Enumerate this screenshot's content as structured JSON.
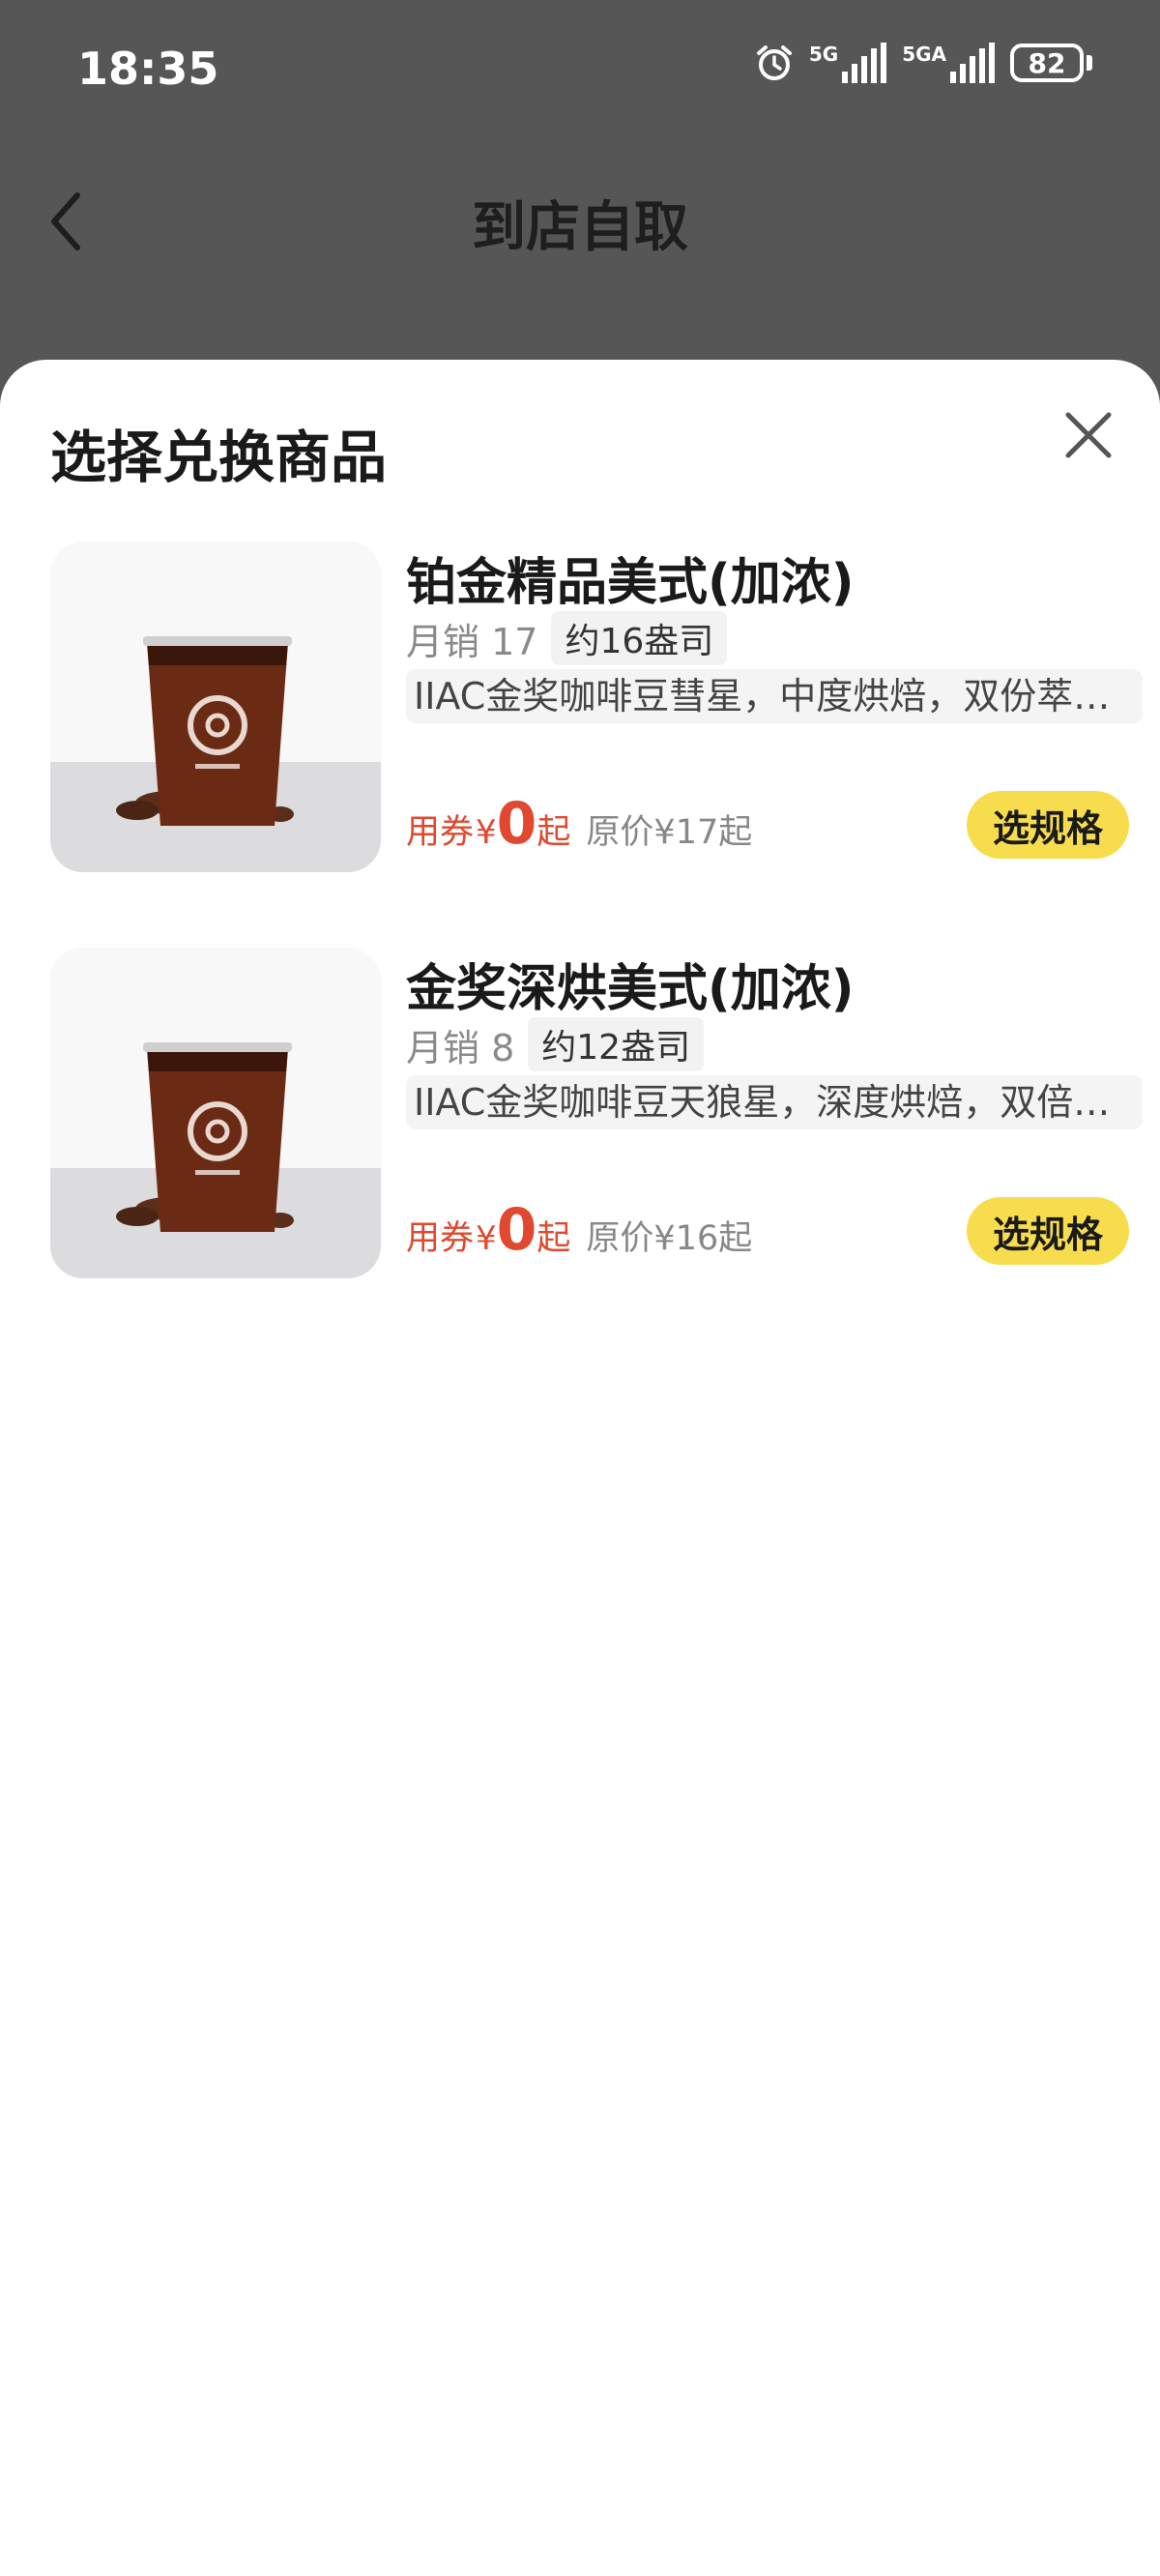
{
  "status_bar": {
    "time": "18:35",
    "network1": "5G",
    "network2": "5GA",
    "battery": "82",
    "icons": [
      "alarm-icon",
      "signal-icon",
      "signal-icon",
      "battery-icon"
    ]
  },
  "nav": {
    "title": "到店自取",
    "back_icon": "chevron-left-icon"
  },
  "sheet": {
    "title": "选择兑换商品",
    "close_icon": "close-icon"
  },
  "products": [
    {
      "name": "铂金精品美式(加浓)",
      "sales": "月销 17",
      "cups": "约16盎司",
      "description": "IIAC金奖咖啡豆彗星，中度烘焙，双份萃…",
      "coupon_label": "用券",
      "currency": "¥",
      "price": "0",
      "price_suffix": "起",
      "original_price": "原价¥17起",
      "button": "选规格"
    },
    {
      "name": "金奖深烘美式(加浓)",
      "sales": "月销 8",
      "cups": "约12盎司",
      "description": "IIAC金奖咖啡豆天狼星，深度烘焙，双倍…",
      "coupon_label": "用券",
      "currency": "¥",
      "price": "0",
      "price_suffix": "起",
      "original_price": "原价¥16起",
      "button": "选规格"
    }
  ],
  "colors": {
    "accent_price": "#e0492f",
    "button_bg": "#f7dd4e",
    "overlay": "#565656"
  }
}
